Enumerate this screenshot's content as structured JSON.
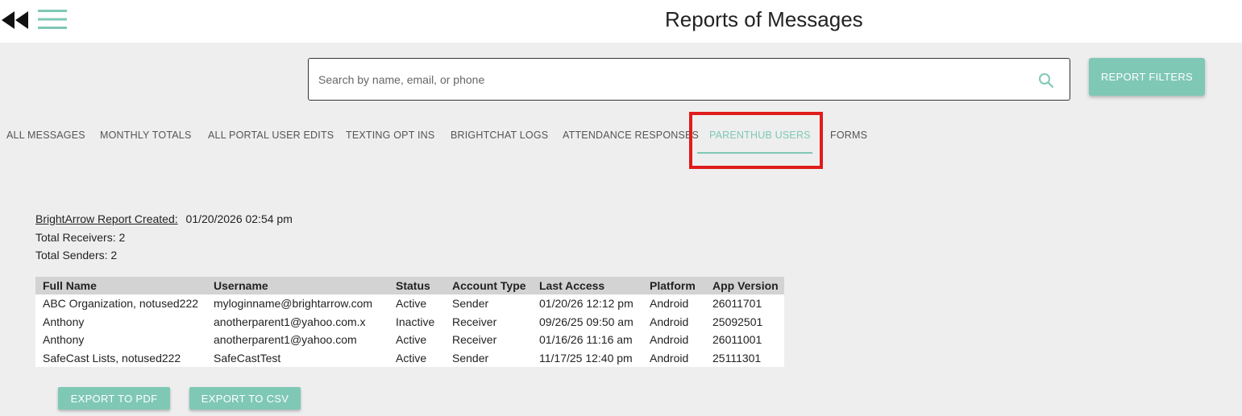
{
  "header": {
    "title": "Reports of Messages",
    "back_icon": "double-arrow-left-icon",
    "menu_icon": "hamburger-menu-icon"
  },
  "search": {
    "placeholder": "Search by name, email, or phone",
    "value": "",
    "icon": "search-icon"
  },
  "filters_button": "REPORT FILTERS",
  "tabs": [
    {
      "label": "ALL MESSAGES"
    },
    {
      "label": "MONTHLY TOTALS"
    },
    {
      "label": "ALL PORTAL USER EDITS"
    },
    {
      "label": "TEXTING OPT INS"
    },
    {
      "label": "BRIGHTCHAT LOGS"
    },
    {
      "label": "ATTENDANCE RESPONSES"
    },
    {
      "label": "PARENTHUB USERS",
      "active": true
    },
    {
      "label": "FORMS"
    }
  ],
  "report": {
    "created_label": "BrightArrow Report Created:",
    "created_value": "01/20/2026 02:54 pm",
    "total_receivers": "Total Receivers: 2",
    "total_senders": "Total Senders: 2"
  },
  "table": {
    "columns": [
      "Full Name",
      "Username",
      "Status",
      "Account Type",
      "Last Access",
      "Platform",
      "App Version"
    ],
    "rows": [
      [
        "ABC Organization, notused222",
        "myloginname@brightarrow.com",
        "Active",
        "Sender",
        "01/20/26 12:12 pm",
        "Android",
        "26011701"
      ],
      [
        "Anthony",
        "anotherparent1@yahoo.com.x",
        "Inactive",
        "Receiver",
        "09/26/25 09:50 am",
        "Android",
        "25092501"
      ],
      [
        "Anthony",
        "anotherparent1@yahoo.com",
        "Active",
        "Receiver",
        "01/16/26 11:16 am",
        "Android",
        "26011001"
      ],
      [
        "SafeCast Lists, notused222",
        "SafeCastTest",
        "Active",
        "Sender",
        "11/17/25 12:40 pm",
        "Android",
        "25111301"
      ]
    ]
  },
  "export": {
    "pdf_label": "EXPORT TO PDF",
    "csv_label": "EXPORT TO CSV"
  },
  "colors": {
    "accent": "#7fc8b6",
    "highlight": "#e01b1b",
    "background": "#eeeeee"
  }
}
